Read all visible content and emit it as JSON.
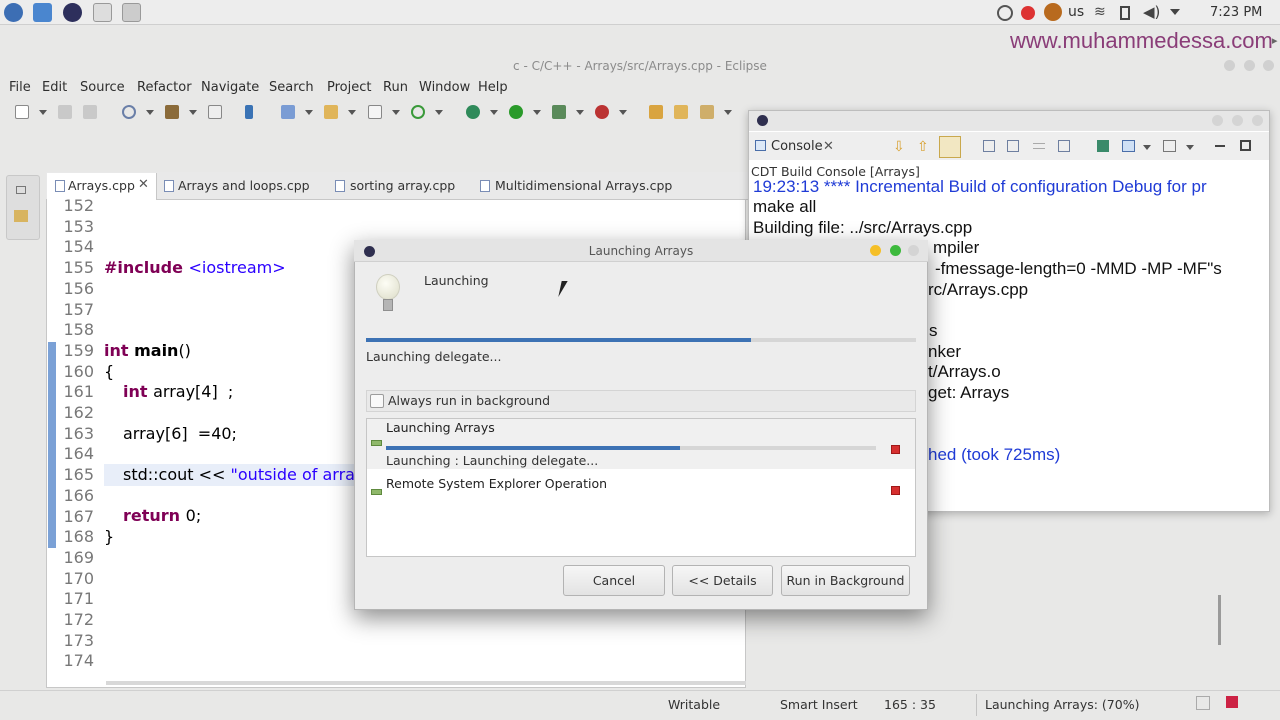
{
  "topbar": {
    "keyboard_layout": "us",
    "clock": "7:23 PM"
  },
  "watermark": "www.muhammedessa.com",
  "window": {
    "title": "c - C/C++ - Arrays/src/Arrays.cpp - Eclipse"
  },
  "menu": [
    "File",
    "Edit",
    "Source",
    "Refactor",
    "Navigate",
    "Search",
    "Project",
    "Run",
    "Window",
    "Help"
  ],
  "editor": {
    "tabs": [
      "Arrays.cpp",
      "Arrays and loops.cpp",
      "sorting array.cpp",
      "Multidimensional Arrays.cpp"
    ],
    "line_numbers": [
      "152",
      "153",
      "154",
      "155",
      "156",
      "157",
      "158",
      "159",
      "160",
      "161",
      "162",
      "163",
      "164",
      "165",
      "166",
      "167",
      "168",
      "169",
      "170",
      "171",
      "172",
      "173",
      "174"
    ],
    "code": {
      "l155a": "#include ",
      "l155b": "<iostream>",
      "l159a": "int ",
      "l159b": "main",
      "l159c": "()",
      "l160": "{",
      "l161a": "int ",
      "l161b": "array[4]  ;",
      "l163": "array[6]  =40;",
      "l165a": "std::cout << ",
      "l165b": "\"outside of arra",
      "l167a": "return ",
      "l167b": "0;",
      "l168": "}"
    }
  },
  "console": {
    "title": "Console",
    "subtitle": "CDT Build Console [Arrays]",
    "lines": [
      "19:23:13 **** Incremental Build of configuration Debug for pr",
      "make all",
      "Building file: ../src/Arrays.cpp",
      "mpiler",
      "-fmessage-length=0 -MMD -MP -MF\"s",
      "rc/Arrays.cpp",
      "s",
      "nker",
      "t/Arrays.o",
      "get: Arrays",
      "hed (took 725ms)"
    ]
  },
  "dialog": {
    "title": "Launching Arrays",
    "heading": "Launching",
    "subtask": "Launching delegate...",
    "main_progress": 0.7,
    "checkbox_label": "Always run in background",
    "jobs": [
      {
        "name": "Launching Arrays",
        "detail": "Launching : Launching delegate...",
        "progress": 0.6
      },
      {
        "name": "Remote System Explorer Operation",
        "detail": ""
      }
    ],
    "buttons": {
      "cancel": "Cancel",
      "details": "<< Details",
      "background": "Run in Background"
    }
  },
  "statusbar": {
    "writable": "Writable",
    "insert_mode": "Smart Insert",
    "position": "165 : 35",
    "progress": "Launching Arrays: (70%)"
  },
  "colors": {
    "accent": "#3d72b4",
    "keyword": "#7f0055",
    "string": "#2a00ff",
    "watermark": "#8a3d78"
  }
}
